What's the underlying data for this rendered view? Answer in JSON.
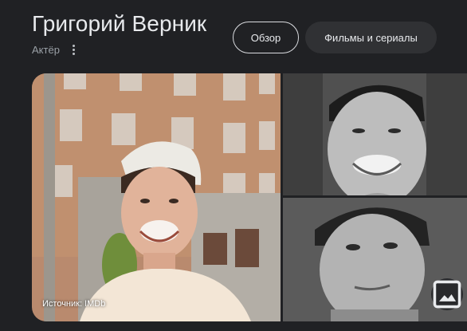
{
  "header": {
    "title": "Григорий Верник",
    "subtitle": "Актёр",
    "more_icon": "more-vert-icon"
  },
  "tabs": [
    {
      "label": "Обзор",
      "selected": true
    },
    {
      "label": "Фильмы и сериалы",
      "selected": false
    }
  ],
  "gallery": {
    "source_caption": "Источник: IMDb",
    "images_button_icon": "image-icon",
    "photos": [
      {
        "name": "main-photo",
        "style": "color"
      },
      {
        "name": "portrait-smiling",
        "style": "grayscale"
      },
      {
        "name": "portrait-serious",
        "style": "grayscale"
      }
    ]
  },
  "colors": {
    "background": "#202124",
    "text_primary": "#e8eaed",
    "text_secondary": "#9aa0a6",
    "pill_filled": "#303134",
    "pill_border": "#dadce0"
  }
}
